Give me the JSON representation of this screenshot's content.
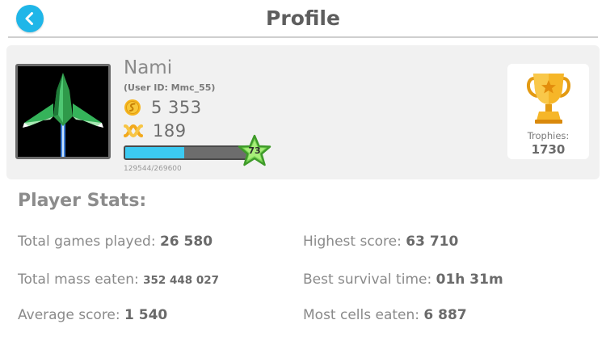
{
  "header": {
    "title": "Profile",
    "back_icon": "chevron-left-icon",
    "accent": "#1fb6e8"
  },
  "profile": {
    "name": "Nami",
    "user_id": "(User ID: Mmc_55)",
    "coins": "5 353",
    "dna": "189",
    "level": "73",
    "xp_text": "129544/269600",
    "xp_fraction": 0.4805,
    "trophies_label": "Trophies:",
    "trophies": "1730"
  },
  "stats": {
    "title": "Player Stats:",
    "items": [
      {
        "label": "Total games played: ",
        "value": "26 580"
      },
      {
        "label": "Highest score: ",
        "value": "63 710"
      },
      {
        "label": "Total mass eaten: ",
        "value": "352 448 027"
      },
      {
        "label": "Best survival time: ",
        "value": "01h 31m"
      },
      {
        "label": "Average score: ",
        "value": "1 540"
      },
      {
        "label": "Most cells eaten: ",
        "value": "6 887"
      }
    ]
  }
}
